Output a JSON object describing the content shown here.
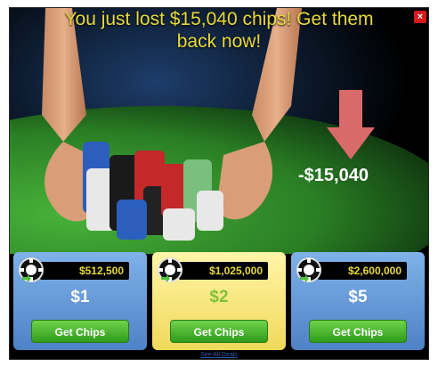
{
  "popup": {
    "headline_line1": "You just lost $15,040 chips! Get them",
    "headline_line2": "back now!",
    "close_label": "×"
  },
  "loss": {
    "amount_text": "-$15,040",
    "arrow_color": "#d96a6a"
  },
  "offers": [
    {
      "chips": "$512,500",
      "price": "$1",
      "button": "Get Chips",
      "style": "blue"
    },
    {
      "chips": "$1,025,000",
      "price": "$2",
      "button": "Get Chips",
      "style": "gold"
    },
    {
      "chips": "$2,600,000",
      "price": "$5",
      "button": "Get Chips",
      "style": "blue"
    }
  ],
  "footer": {
    "see_all": "See All Deals"
  },
  "colors": {
    "headline": "#e8d93a",
    "table_felt": "#2f8a2a",
    "button_green": "#3aa526"
  },
  "icons": [
    "close-icon",
    "down-arrow-icon",
    "poker-chip-icon"
  ]
}
